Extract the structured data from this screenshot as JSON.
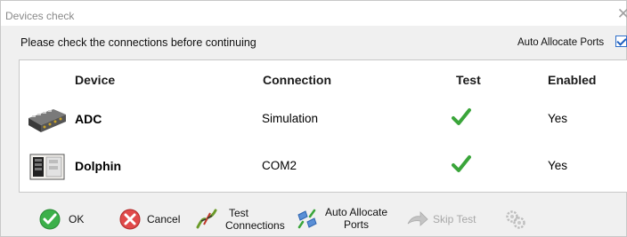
{
  "window": {
    "title": "Devices check"
  },
  "instruction": "Please check the connections before continuing",
  "auto_allocate_checkbox": {
    "label": "Auto Allocate Ports",
    "checked": true
  },
  "table": {
    "headers": {
      "device": "Device",
      "connection": "Connection",
      "test": "Test",
      "enabled": "Enabled"
    },
    "rows": [
      {
        "device": "ADC",
        "connection": "Simulation",
        "test": "passed",
        "enabled": "Yes"
      },
      {
        "device": "Dolphin",
        "connection": "COM2",
        "test": "passed",
        "enabled": "Yes"
      }
    ]
  },
  "buttons": {
    "ok": "OK",
    "cancel": "Cancel",
    "test_connections_1": "Test",
    "test_connections_2": "Connections",
    "auto_allocate_1": "Auto Allocate",
    "auto_allocate_2": "Ports",
    "skip_test": "Skip Test"
  },
  "icons": {
    "ok": "green-check-circle-icon",
    "cancel": "red-x-circle-icon",
    "test_connections": "broken-wire-icon",
    "auto_allocate": "plug-arrows-icon",
    "skip_test": "forward-arrow-icon",
    "unnamed": "gears-icon"
  },
  "colors": {
    "test_pass": "#3aa53a",
    "check": "#1f5fbf"
  }
}
